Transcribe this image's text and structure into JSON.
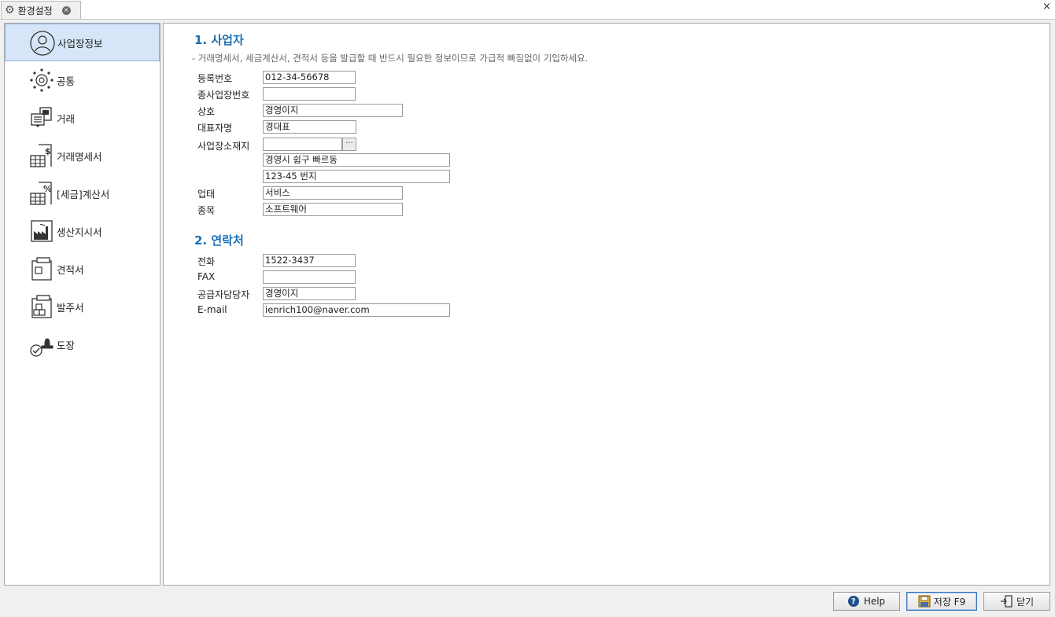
{
  "window": {
    "tab_title": "환경설정",
    "tab_icon": "gear-icon",
    "tab_close": "×",
    "close": "×"
  },
  "sidebar": {
    "items": [
      {
        "label": "사업장정보",
        "icon": "user-circle-icon",
        "active": true
      },
      {
        "label": "공통",
        "icon": "sun-gear-icon"
      },
      {
        "label": "거래",
        "icon": "document-stack-icon"
      },
      {
        "label": "거래명세서",
        "icon": "dollar-sheet-icon"
      },
      {
        "label": "[세금]계산서",
        "icon": "percent-sheet-icon"
      },
      {
        "label": "생산지시서",
        "icon": "factory-icon"
      },
      {
        "label": "견적서",
        "icon": "clipboard-icon"
      },
      {
        "label": "발주서",
        "icon": "boxes-clipboard-icon"
      },
      {
        "label": "도장",
        "icon": "stamp-icon"
      }
    ]
  },
  "section1": {
    "title": "1. 사업자",
    "description": "- 거래명세서, 세금계산서, 견적서 등을 발급할 때 반드시 필요한 정보이므로 가급적 빠짐없이 기입하세요.",
    "fields": {
      "reg_no": {
        "label": "등록번호",
        "value": "012-34-56678"
      },
      "sub_no": {
        "label": "종사업장번호",
        "value": ""
      },
      "company": {
        "label": "상호",
        "value": "경영이지"
      },
      "ceo": {
        "label": "대표자명",
        "value": "경대표"
      },
      "address": {
        "label": "사업장소재지",
        "postcode": "",
        "line1": "경영시 쉽구 빠르동",
        "line2": "123-45 번지",
        "search_button": "···"
      },
      "biz_type": {
        "label": "업태",
        "value": "서비스"
      },
      "biz_item": {
        "label": "종목",
        "value": "소프트웨어"
      }
    }
  },
  "section2": {
    "title": "2. 연락처",
    "fields": {
      "phone": {
        "label": "전화",
        "value": "1522-3437"
      },
      "fax": {
        "label": "FAX",
        "value": ""
      },
      "manager": {
        "label": "공급자담당자",
        "value": "경영이지"
      },
      "email": {
        "label": "E-mail",
        "value": "ienrich100@naver.com"
      }
    }
  },
  "buttons": {
    "help": "Help",
    "save": "저장 F9",
    "close": "닫기"
  }
}
